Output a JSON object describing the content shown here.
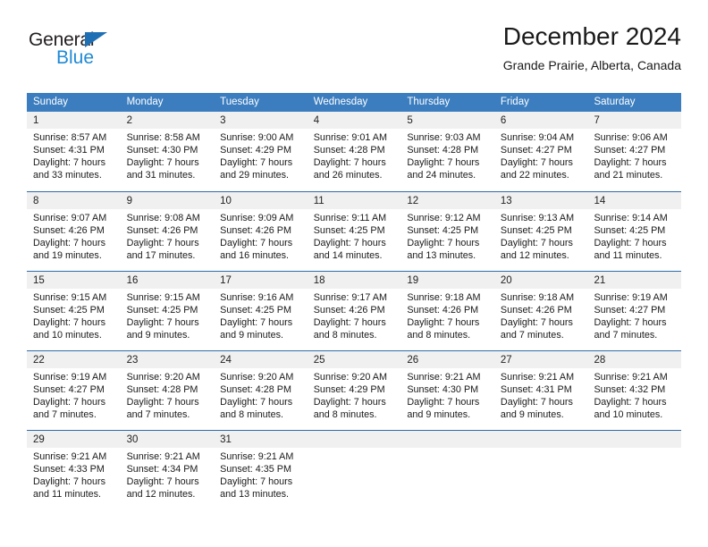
{
  "brand": {
    "name_part1": "General",
    "name_part2": "Blue",
    "triangle_icon": "triangle-icon",
    "primary_color": "#1f6fb4",
    "accent_color": "#1f8ad6"
  },
  "header": {
    "title": "December 2024",
    "subtitle": "Grande Prairie, Alberta, Canada"
  },
  "calendar": {
    "header_bg_color": "#3b7dbf",
    "row_border_color": "#2f6ca8",
    "day_band_color": "#f0f0f0",
    "weekdays": [
      "Sunday",
      "Monday",
      "Tuesday",
      "Wednesday",
      "Thursday",
      "Friday",
      "Saturday"
    ],
    "weeks": [
      [
        {
          "day": "1",
          "lines": [
            "Sunrise: 8:57 AM",
            "Sunset: 4:31 PM",
            "Daylight: 7 hours",
            "and 33 minutes."
          ]
        },
        {
          "day": "2",
          "lines": [
            "Sunrise: 8:58 AM",
            "Sunset: 4:30 PM",
            "Daylight: 7 hours",
            "and 31 minutes."
          ]
        },
        {
          "day": "3",
          "lines": [
            "Sunrise: 9:00 AM",
            "Sunset: 4:29 PM",
            "Daylight: 7 hours",
            "and 29 minutes."
          ]
        },
        {
          "day": "4",
          "lines": [
            "Sunrise: 9:01 AM",
            "Sunset: 4:28 PM",
            "Daylight: 7 hours",
            "and 26 minutes."
          ]
        },
        {
          "day": "5",
          "lines": [
            "Sunrise: 9:03 AM",
            "Sunset: 4:28 PM",
            "Daylight: 7 hours",
            "and 24 minutes."
          ]
        },
        {
          "day": "6",
          "lines": [
            "Sunrise: 9:04 AM",
            "Sunset: 4:27 PM",
            "Daylight: 7 hours",
            "and 22 minutes."
          ]
        },
        {
          "day": "7",
          "lines": [
            "Sunrise: 9:06 AM",
            "Sunset: 4:27 PM",
            "Daylight: 7 hours",
            "and 21 minutes."
          ]
        }
      ],
      [
        {
          "day": "8",
          "lines": [
            "Sunrise: 9:07 AM",
            "Sunset: 4:26 PM",
            "Daylight: 7 hours",
            "and 19 minutes."
          ]
        },
        {
          "day": "9",
          "lines": [
            "Sunrise: 9:08 AM",
            "Sunset: 4:26 PM",
            "Daylight: 7 hours",
            "and 17 minutes."
          ]
        },
        {
          "day": "10",
          "lines": [
            "Sunrise: 9:09 AM",
            "Sunset: 4:26 PM",
            "Daylight: 7 hours",
            "and 16 minutes."
          ]
        },
        {
          "day": "11",
          "lines": [
            "Sunrise: 9:11 AM",
            "Sunset: 4:25 PM",
            "Daylight: 7 hours",
            "and 14 minutes."
          ]
        },
        {
          "day": "12",
          "lines": [
            "Sunrise: 9:12 AM",
            "Sunset: 4:25 PM",
            "Daylight: 7 hours",
            "and 13 minutes."
          ]
        },
        {
          "day": "13",
          "lines": [
            "Sunrise: 9:13 AM",
            "Sunset: 4:25 PM",
            "Daylight: 7 hours",
            "and 12 minutes."
          ]
        },
        {
          "day": "14",
          "lines": [
            "Sunrise: 9:14 AM",
            "Sunset: 4:25 PM",
            "Daylight: 7 hours",
            "and 11 minutes."
          ]
        }
      ],
      [
        {
          "day": "15",
          "lines": [
            "Sunrise: 9:15 AM",
            "Sunset: 4:25 PM",
            "Daylight: 7 hours",
            "and 10 minutes."
          ]
        },
        {
          "day": "16",
          "lines": [
            "Sunrise: 9:15 AM",
            "Sunset: 4:25 PM",
            "Daylight: 7 hours",
            "and 9 minutes."
          ]
        },
        {
          "day": "17",
          "lines": [
            "Sunrise: 9:16 AM",
            "Sunset: 4:25 PM",
            "Daylight: 7 hours",
            "and 9 minutes."
          ]
        },
        {
          "day": "18",
          "lines": [
            "Sunrise: 9:17 AM",
            "Sunset: 4:26 PM",
            "Daylight: 7 hours",
            "and 8 minutes."
          ]
        },
        {
          "day": "19",
          "lines": [
            "Sunrise: 9:18 AM",
            "Sunset: 4:26 PM",
            "Daylight: 7 hours",
            "and 8 minutes."
          ]
        },
        {
          "day": "20",
          "lines": [
            "Sunrise: 9:18 AM",
            "Sunset: 4:26 PM",
            "Daylight: 7 hours",
            "and 7 minutes."
          ]
        },
        {
          "day": "21",
          "lines": [
            "Sunrise: 9:19 AM",
            "Sunset: 4:27 PM",
            "Daylight: 7 hours",
            "and 7 minutes."
          ]
        }
      ],
      [
        {
          "day": "22",
          "lines": [
            "Sunrise: 9:19 AM",
            "Sunset: 4:27 PM",
            "Daylight: 7 hours",
            "and 7 minutes."
          ]
        },
        {
          "day": "23",
          "lines": [
            "Sunrise: 9:20 AM",
            "Sunset: 4:28 PM",
            "Daylight: 7 hours",
            "and 7 minutes."
          ]
        },
        {
          "day": "24",
          "lines": [
            "Sunrise: 9:20 AM",
            "Sunset: 4:28 PM",
            "Daylight: 7 hours",
            "and 8 minutes."
          ]
        },
        {
          "day": "25",
          "lines": [
            "Sunrise: 9:20 AM",
            "Sunset: 4:29 PM",
            "Daylight: 7 hours",
            "and 8 minutes."
          ]
        },
        {
          "day": "26",
          "lines": [
            "Sunrise: 9:21 AM",
            "Sunset: 4:30 PM",
            "Daylight: 7 hours",
            "and 9 minutes."
          ]
        },
        {
          "day": "27",
          "lines": [
            "Sunrise: 9:21 AM",
            "Sunset: 4:31 PM",
            "Daylight: 7 hours",
            "and 9 minutes."
          ]
        },
        {
          "day": "28",
          "lines": [
            "Sunrise: 9:21 AM",
            "Sunset: 4:32 PM",
            "Daylight: 7 hours",
            "and 10 minutes."
          ]
        }
      ],
      [
        {
          "day": "29",
          "lines": [
            "Sunrise: 9:21 AM",
            "Sunset: 4:33 PM",
            "Daylight: 7 hours",
            "and 11 minutes."
          ]
        },
        {
          "day": "30",
          "lines": [
            "Sunrise: 9:21 AM",
            "Sunset: 4:34 PM",
            "Daylight: 7 hours",
            "and 12 minutes."
          ]
        },
        {
          "day": "31",
          "lines": [
            "Sunrise: 9:21 AM",
            "Sunset: 4:35 PM",
            "Daylight: 7 hours",
            "and 13 minutes."
          ]
        },
        {
          "day": "",
          "lines": []
        },
        {
          "day": "",
          "lines": []
        },
        {
          "day": "",
          "lines": []
        },
        {
          "day": "",
          "lines": []
        }
      ]
    ]
  }
}
